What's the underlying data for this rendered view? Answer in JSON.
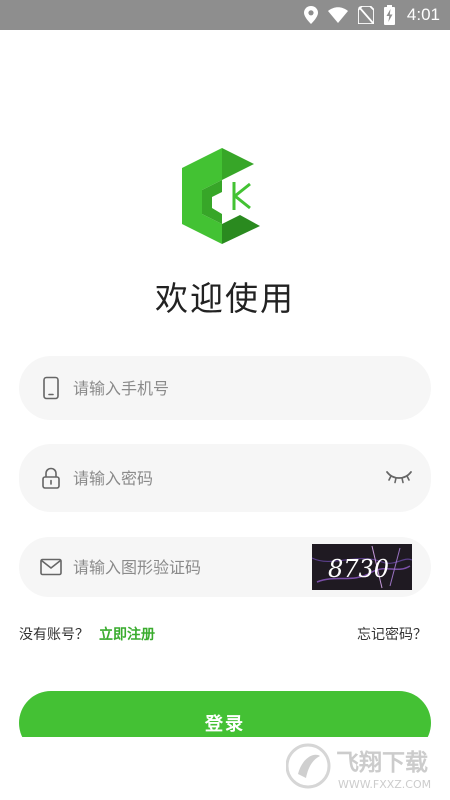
{
  "status_bar": {
    "time": "4:01",
    "icons": [
      "location-icon",
      "wifi-icon",
      "no-sim-icon",
      "battery-charging-icon"
    ]
  },
  "logo": {
    "letter": "K",
    "colors": {
      "light": "#43c233",
      "mid": "#37a628",
      "dark": "#2a8a1f"
    }
  },
  "title": "欢迎使用",
  "form": {
    "phone": {
      "placeholder": "请输入手机号",
      "value": "",
      "icon": "phone-icon"
    },
    "password": {
      "placeholder": "请输入密码",
      "value": "",
      "icon": "lock-icon",
      "toggle_icon": "eye-closed-icon"
    },
    "captcha": {
      "placeholder": "请输入图形验证码",
      "value": "",
      "icon": "mail-icon",
      "image_text": "8730"
    }
  },
  "links": {
    "no_account": "没有账号？",
    "register": "立即注册",
    "forgot": "忘记密码？"
  },
  "login_button": "登录",
  "watermark": {
    "brand": "飞翔下载",
    "url": "WWW.FXXZ.COM"
  },
  "colors": {
    "accent": "#44c134",
    "link": "#3aac2e",
    "field_bg": "#f6f6f6",
    "status_bar": "#8e8e8e"
  }
}
